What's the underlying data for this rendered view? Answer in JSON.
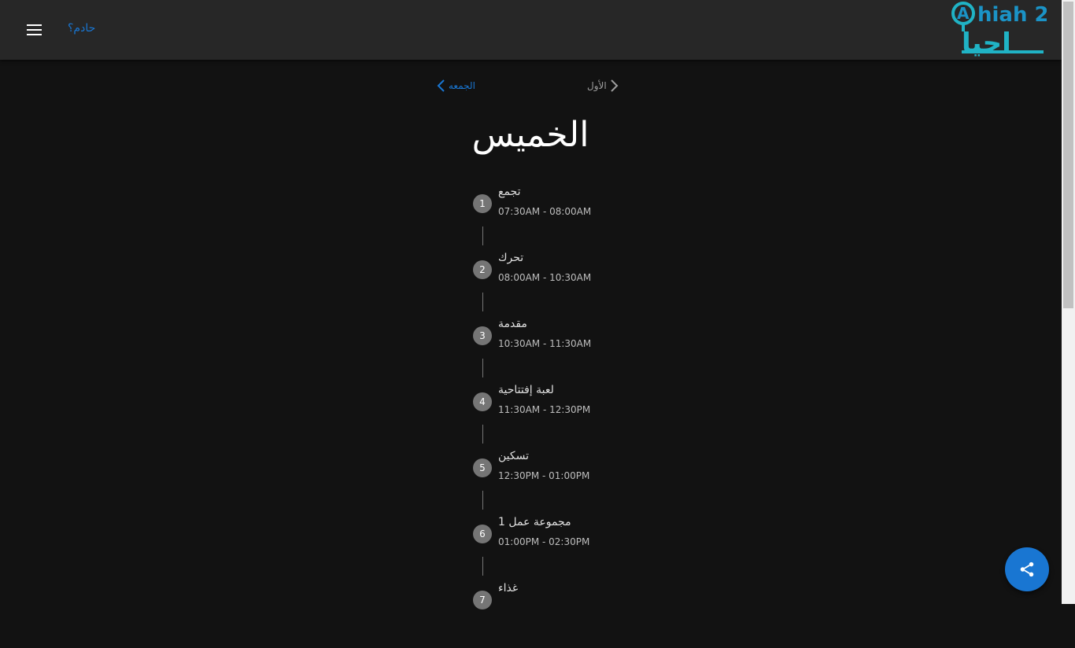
{
  "header": {
    "servant_link": "حادم؟",
    "logo_text_latin": "Ahiah 2",
    "logo_text_arabic": "احيا",
    "brand_color": "#1b93c6",
    "accent_color": "#20b3c5"
  },
  "nav": {
    "prev_label": "الأول",
    "next_label": "الجمعه"
  },
  "day_title": "الخميس",
  "schedule": [
    {
      "num": "1",
      "label": "تجمع",
      "time": "07:30AM - 08:00AM"
    },
    {
      "num": "2",
      "label": "تحرك",
      "time": "08:00AM - 10:30AM"
    },
    {
      "num": "3",
      "label": "مقدمة",
      "time": "10:30AM - 11:30AM"
    },
    {
      "num": "4",
      "label": "لعبة إفتتاحية",
      "time": "11:30AM - 12:30PM"
    },
    {
      "num": "5",
      "label": "تسكين",
      "time": "12:30PM - 01:00PM"
    },
    {
      "num": "6",
      "label": "مجموعة عمل 1",
      "time": "01:00PM - 02:30PM"
    },
    {
      "num": "7",
      "label": "غذاء",
      "time": ""
    }
  ],
  "colors": {
    "background": "#121212",
    "header_bg": "#272727",
    "link": "#1976d2",
    "step_circle": "#757575"
  }
}
